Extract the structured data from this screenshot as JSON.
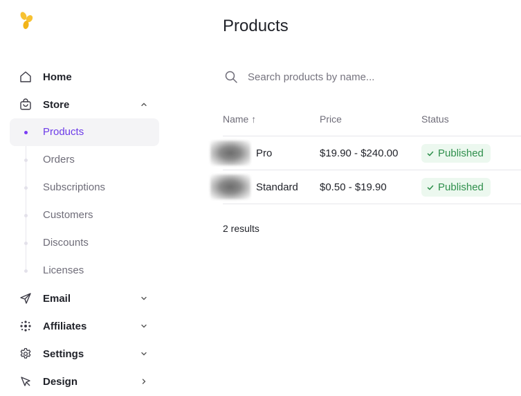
{
  "sidebar": {
    "items": [
      {
        "label": "Home",
        "icon": "home-icon"
      },
      {
        "label": "Store",
        "icon": "shopping-bag-icon"
      },
      {
        "label": "Email",
        "icon": "send-icon"
      },
      {
        "label": "Affiliates",
        "icon": "affiliates-icon"
      },
      {
        "label": "Settings",
        "icon": "gear-icon"
      },
      {
        "label": "Design",
        "icon": "cursor-icon"
      }
    ],
    "store_sub": [
      {
        "label": "Products",
        "active": true
      },
      {
        "label": "Orders"
      },
      {
        "label": "Subscriptions"
      },
      {
        "label": "Customers"
      },
      {
        "label": "Discounts"
      },
      {
        "label": "Licenses"
      }
    ]
  },
  "main": {
    "title": "Products",
    "search": {
      "placeholder": "Search products by name...",
      "value": ""
    },
    "table": {
      "columns": [
        {
          "label": "Name ↑"
        },
        {
          "label": "Price"
        },
        {
          "label": "Status"
        }
      ],
      "rows": [
        {
          "name": "Pro",
          "price": "$19.90 - $240.00",
          "status": "Published"
        },
        {
          "name": "Standard",
          "price": "$0.50 - $19.90",
          "status": "Published"
        }
      ]
    },
    "results": "2 results"
  },
  "colors": {
    "accent": "#6d3ce8",
    "logo": "#f7c233",
    "status_published_bg": "#ecf8ef",
    "status_published_text": "#2f8f4c"
  }
}
